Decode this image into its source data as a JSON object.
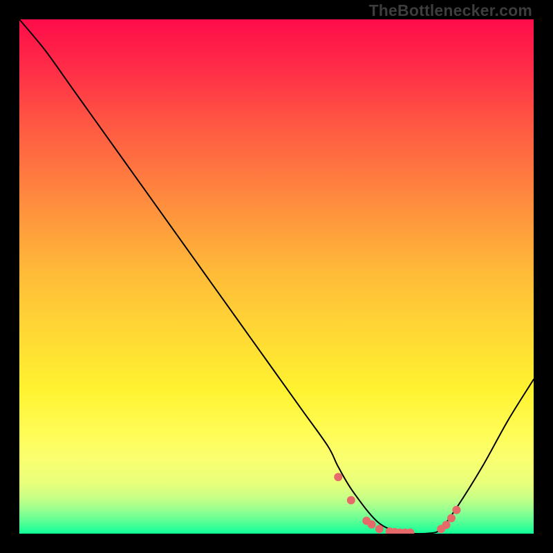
{
  "chart_data": {
    "type": "line",
    "title": "",
    "xlabel": "",
    "ylabel": "",
    "x_range": [
      0,
      100
    ],
    "y_range": [
      0,
      100
    ],
    "series": [
      {
        "name": "curve",
        "x": [
          0,
          5,
          10,
          15,
          20,
          25,
          30,
          35,
          40,
          45,
          50,
          55,
          60,
          62,
          65,
          70,
          75,
          80,
          82,
          85,
          90,
          95,
          100
        ],
        "y": [
          100,
          94,
          87,
          80,
          73,
          66,
          59,
          52,
          45,
          38,
          31,
          24,
          17,
          13,
          8,
          2,
          0.2,
          0.1,
          1,
          5,
          13,
          22,
          30
        ],
        "color": "#000000",
        "linewidth": 2
      }
    ],
    "markers": {
      "name": "points",
      "x": [
        62,
        64.5,
        67.5,
        68.5,
        70,
        72,
        73,
        74,
        75,
        76,
        82,
        83,
        84,
        85
      ],
      "y": [
        11,
        6.5,
        2.5,
        1.8,
        0.9,
        0.4,
        0.3,
        0.2,
        0.2,
        0.2,
        0.9,
        1.7,
        3.0,
        4.6
      ],
      "color": "#e66a6a",
      "radius": 6
    },
    "background_gradient": {
      "stops": [
        {
          "offset": 0.0,
          "color": "#ff0c4a"
        },
        {
          "offset": 0.5,
          "color": "#ffbd38"
        },
        {
          "offset": 0.8,
          "color": "#fffc54"
        },
        {
          "offset": 1.0,
          "color": "#11ff99"
        }
      ]
    }
  },
  "watermark": "TheBottlenecker.com"
}
